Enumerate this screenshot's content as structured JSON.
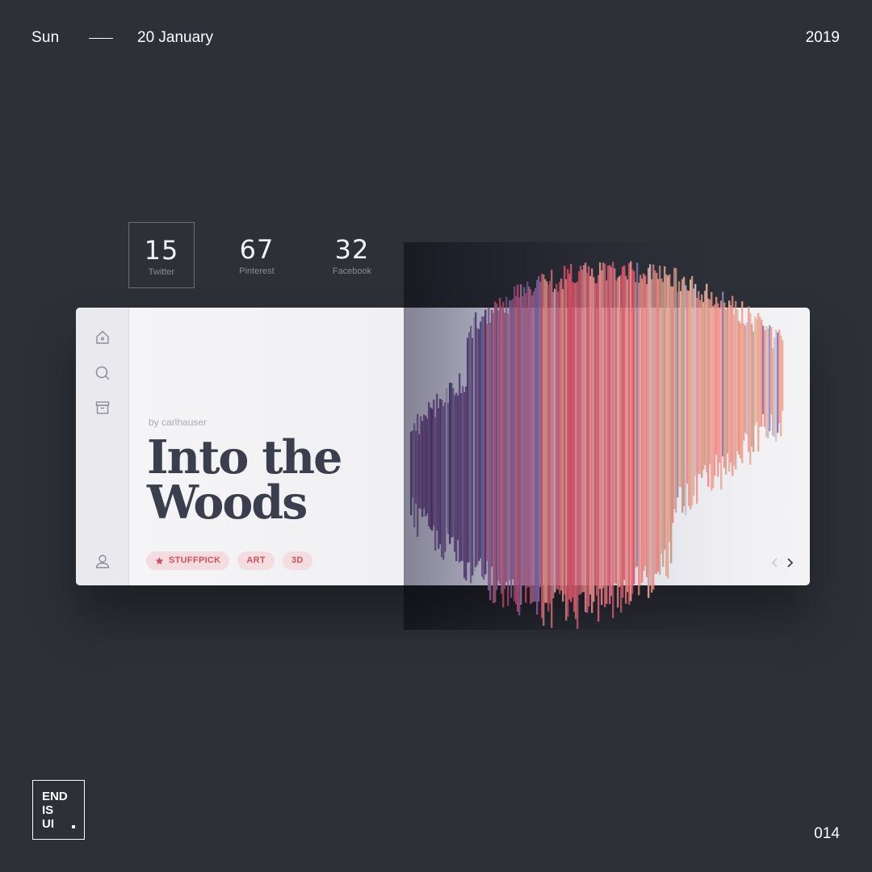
{
  "header": {
    "day": "Sun",
    "date": "20 January",
    "year": "2019"
  },
  "stats": [
    {
      "value": "15",
      "label": "Twitter",
      "active": true
    },
    {
      "value": "67",
      "label": "Pinterest",
      "active": false
    },
    {
      "value": "32",
      "label": "Facebook",
      "active": false
    }
  ],
  "card": {
    "byline": "by carlhauser",
    "title_line1": "Into the",
    "title_line2": "Woods",
    "tags": [
      "STUFFPICK",
      "ART",
      "3D"
    ],
    "sidebar_icons": [
      "home-icon",
      "search-icon",
      "archive-icon",
      "user-icon"
    ]
  },
  "footer": {
    "logo": "END\nIS\nUI",
    "page_number": "014"
  },
  "colors": {
    "background": "#2e3038",
    "card": "#f3f3f5",
    "title": "#3b3e4d",
    "tag_bg": "#f3dde0",
    "tag_text": "#d2505e"
  }
}
